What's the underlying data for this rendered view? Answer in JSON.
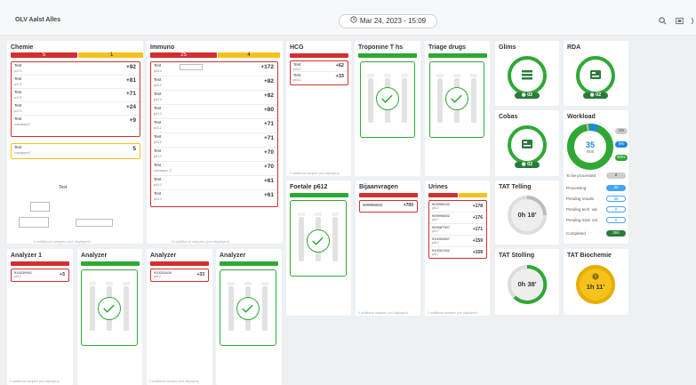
{
  "header": {
    "brand": "OLV Aalst Alles",
    "datetime": "Mar 24, 2023 - 15:09"
  },
  "chemie": {
    "title": "Chemie",
    "red_count": "5",
    "yellow_count": "1",
    "rows": [
      {
        "name": "Test",
        "sub": "p471",
        "value": "+92"
      },
      {
        "name": "Test",
        "sub": "p471",
        "value": "+81"
      },
      {
        "name": "Test",
        "sub": "p471",
        "value": "+71"
      },
      {
        "name": "Test",
        "sub": "p471",
        "value": "+24"
      },
      {
        "name": "Test",
        "sub": "cobaspro7",
        "value": "+9"
      }
    ],
    "yellow_row": {
      "name": "Test",
      "sub": "cobaspro7",
      "value": "5"
    },
    "test_label": "Test",
    "footer": "0 additional samples (not displayed)"
  },
  "immuno": {
    "title": "Immuno",
    "red_count": "25",
    "yellow_count": "4",
    "rows": [
      {
        "name": "Test",
        "sub": "p614",
        "value": "+172"
      },
      {
        "name": "Test",
        "sub": "p612",
        "value": "+82"
      },
      {
        "name": "Test",
        "sub": "p614",
        "value": "+82"
      },
      {
        "name": "Test",
        "sub": "p612",
        "value": "+80"
      },
      {
        "name": "Test",
        "sub": "p612",
        "value": "+71"
      },
      {
        "name": "Test",
        "sub": "p612",
        "value": "+71"
      },
      {
        "name": "Test",
        "sub": "p617",
        "value": "+70"
      },
      {
        "name": "Test",
        "sub": "cobaspro 2",
        "value": "+70"
      },
      {
        "name": "Test",
        "sub": "p612",
        "value": "+61"
      },
      {
        "name": "Test",
        "sub": "p614",
        "value": "+61"
      }
    ],
    "footer": "15 additional samples (not displayed)"
  },
  "hcg": {
    "title": "HCG",
    "rows": [
      {
        "name": "Test",
        "sub": "p612",
        "value": "+62"
      },
      {
        "name": "Test",
        "sub": "p612",
        "value": "+33"
      }
    ],
    "footer": "0 additional samples (not displayed)"
  },
  "troponine": {
    "title": "Troponine T hs"
  },
  "triage": {
    "title": "Triage drugs"
  },
  "glims": {
    "title": "Glims",
    "badge": "02"
  },
  "rda": {
    "title": "RDA",
    "badge": "02"
  },
  "cobas": {
    "title": "Cobas",
    "badge": "02"
  },
  "workload": {
    "title": "Workload",
    "center_value": "35",
    "center_sub": "/506",
    "badges": [
      "1%",
      "5%",
      "93%"
    ],
    "rows": [
      {
        "label": "To be processed",
        "value": "2"
      },
      {
        "label": "Processing",
        "value": "30"
      },
      {
        "label": "Pending results",
        "value": "35"
      },
      {
        "label": "Pending tech. val.",
        "value": "0"
      },
      {
        "label": "Pending med. val.",
        "value": "0"
      },
      {
        "label": "Completed",
        "value": "384"
      }
    ]
  },
  "foetale": {
    "title": "Foetale p612"
  },
  "bijaanvragen": {
    "title": "Bijaanvragen",
    "rows": [
      {
        "name": "909996502",
        "sub": "",
        "value": "+700"
      }
    ]
  },
  "urines": {
    "title": "Urines",
    "rows": [
      {
        "name": "909996102",
        "sub": "p612",
        "value": "+178"
      },
      {
        "name": "909996802",
        "sub": "p617",
        "value": "+176"
      },
      {
        "name": "909987907",
        "sub": "p617",
        "value": "+171"
      },
      {
        "name": "910000807",
        "sub": "p617",
        "value": "+159"
      },
      {
        "name": "910001302",
        "sub": "p617",
        "value": "+158"
      }
    ],
    "footer": "0 additional samples (not displayed)"
  },
  "bij_footer": "0 additional samples (not displayed)",
  "tat_telling": {
    "title": "TAT Telling",
    "value": "0h 18'"
  },
  "tat_stolling": {
    "title": "TAT Stolling",
    "value": "0h 38'"
  },
  "tat_biochemie": {
    "title": "TAT Biochemie",
    "value": "1h 11'"
  },
  "analyzer1": {
    "title": "Analyzer 1",
    "rows": [
      {
        "name": "910039901",
        "sub": "p612",
        "value": "+5"
      }
    ],
    "footer": "0 additional samples (not displayed)"
  },
  "analyzer2": {
    "title": "Analyzer"
  },
  "analyzer3": {
    "title": "Analyzer",
    "rows": [
      {
        "name": "910031604",
        "sub": "p612",
        "value": "+33"
      }
    ],
    "footer": "0 additional samples (not displayed)"
  },
  "analyzer4": {
    "title": "Analyzer"
  },
  "colors": {
    "red": "#d32f2f",
    "yellow": "#f5c11a",
    "green": "#2fa833",
    "dark_green": "#2b7a3c",
    "blue": "#1e88e5"
  }
}
